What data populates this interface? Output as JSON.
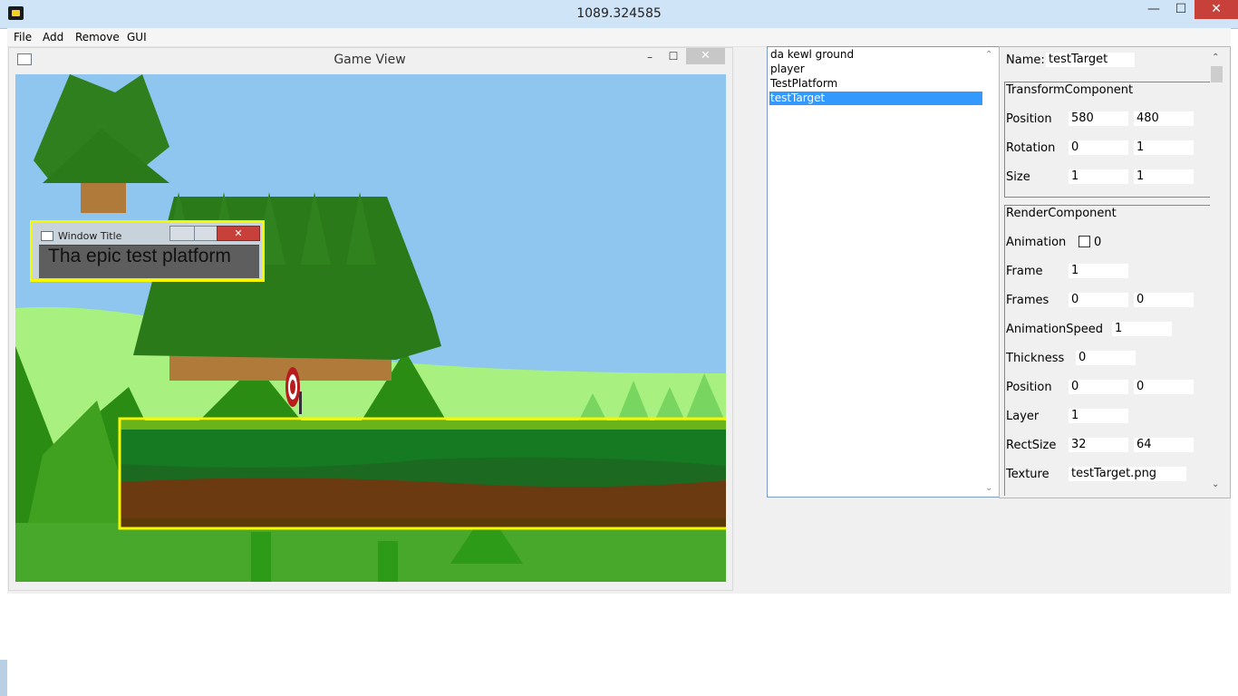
{
  "window": {
    "title": "1089.324585",
    "min_label": "—",
    "max_label": "☐",
    "close_label": "✕"
  },
  "menu": [
    "File",
    "Add",
    "Remove",
    "GUI"
  ],
  "game_view": {
    "title": "Game View",
    "min_label": "–",
    "max_label": "☐",
    "close_label": "✕"
  },
  "ingame_window": {
    "title": "Window Title",
    "content": "Tha epic test platform"
  },
  "entities": {
    "items": [
      {
        "label": "da kewl ground",
        "selected": false
      },
      {
        "label": "player",
        "selected": false
      },
      {
        "label": "TestPlatform",
        "selected": false
      },
      {
        "label": "testTarget",
        "selected": true
      }
    ]
  },
  "properties": {
    "name_label": "Name:",
    "name_value": "testTarget",
    "transform": {
      "header": "TransformComponent",
      "position": {
        "label": "Position",
        "x": "580",
        "y": "480"
      },
      "rotation": {
        "label": "Rotation",
        "a": "0",
        "b": "1"
      },
      "size": {
        "label": "Size",
        "w": "1",
        "h": "1"
      }
    },
    "render": {
      "header": "RenderComponent",
      "animation": {
        "label": "Animation",
        "value": "0",
        "checked": false
      },
      "frame": {
        "label": "Frame",
        "value": "1"
      },
      "frames": {
        "label": "Frames",
        "a": "0",
        "b": "0"
      },
      "animation_speed": {
        "label": "AnimationSpeed",
        "value": "1"
      },
      "thickness": {
        "label": "Thickness",
        "value": "0"
      },
      "position": {
        "label": "Position",
        "x": "0",
        "y": "0"
      },
      "layer": {
        "label": "Layer",
        "value": "1"
      },
      "rect_size": {
        "label": "RectSize",
        "w": "32",
        "h": "64"
      },
      "texture": {
        "label": "Texture",
        "value": "testTarget.png"
      }
    }
  },
  "colors": {
    "selection": "#3399ff",
    "outline": "#f7f700",
    "sky": "#8ec6f0",
    "close": "#c7413a"
  }
}
